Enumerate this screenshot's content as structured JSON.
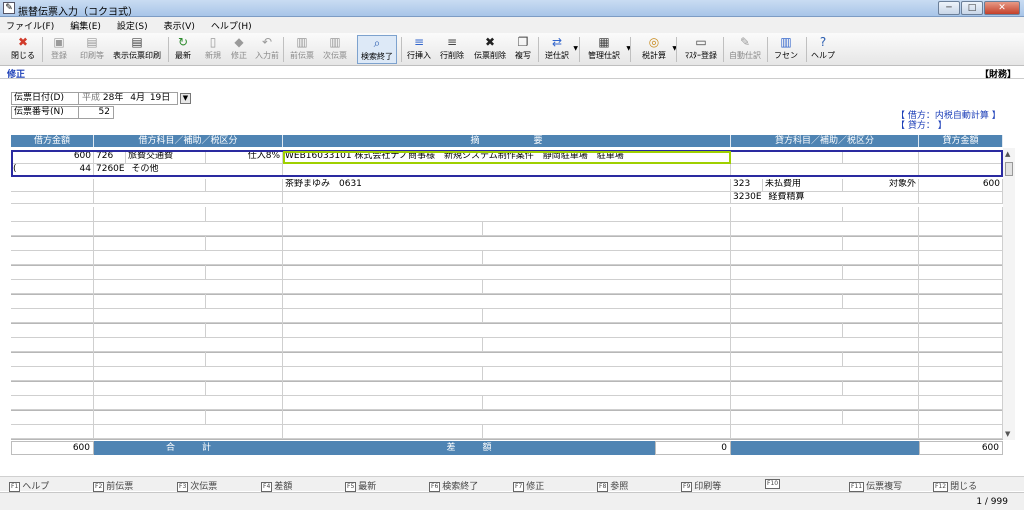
{
  "window": {
    "app_icon": "ledger-icon",
    "title": "振替伝票入力（コクヨ式）",
    "buttons": {
      "minimize": "─",
      "maximize": "□",
      "close": "✕"
    }
  },
  "menu": [
    "ファイル(F)",
    "編集(E)",
    "設定(S)",
    "表示(V)",
    "ヘルプ(H)"
  ],
  "toolbar": [
    {
      "id": "close",
      "label": "閉じる",
      "icon": "✖",
      "color": "#d13b2b",
      "enabled": true
    },
    {
      "id": "register",
      "label": "登録",
      "icon": "▣",
      "color": "#9a9a9a",
      "enabled": false
    },
    {
      "id": "print",
      "label": "印刷等",
      "icon": "▤",
      "color": "#9a9a9a",
      "enabled": false
    },
    {
      "id": "print-shown",
      "label": "表示伝票印刷",
      "icon": "▤",
      "color": "#444444",
      "enabled": true
    },
    {
      "id": "refresh",
      "label": "最新",
      "icon": "↻",
      "color": "#2e8b2e",
      "enabled": true
    },
    {
      "id": "new",
      "label": "新規",
      "icon": "▯",
      "color": "#9a9a9a",
      "enabled": false
    },
    {
      "id": "edit",
      "label": "修正",
      "icon": "◆",
      "color": "#9a9a9a",
      "enabled": false
    },
    {
      "id": "input-prev",
      "label": "入力前",
      "icon": "↶",
      "color": "#9a9a9a",
      "enabled": false
    },
    {
      "id": "prev-slip",
      "label": "前伝票",
      "icon": "▥",
      "color": "#9a9a9a",
      "enabled": false
    },
    {
      "id": "next-slip",
      "label": "次伝票",
      "icon": "▥",
      "color": "#9a9a9a",
      "enabled": false
    },
    {
      "id": "search-end",
      "label": "検索終了",
      "icon": "⌕",
      "color": "#2a5db0",
      "enabled": true,
      "pressed": true
    },
    {
      "id": "row-insert",
      "label": "行挿入",
      "icon": "≡",
      "color": "#3366cc",
      "enabled": true
    },
    {
      "id": "row-delete",
      "label": "行削除",
      "icon": "≡",
      "color": "#444444",
      "enabled": true
    },
    {
      "id": "slip-delete",
      "label": "伝票削除",
      "icon": "✖",
      "color": "#222222",
      "enabled": true
    },
    {
      "id": "copy",
      "label": "複写",
      "icon": "❐",
      "color": "#444444",
      "enabled": true
    },
    {
      "id": "reverse-journal",
      "label": "逆仕訳",
      "icon": "⇄",
      "color": "#3366cc",
      "enabled": true,
      "dropdown": true
    },
    {
      "id": "mgmt-journal",
      "label": "管理仕訳",
      "icon": "▦",
      "color": "#444444",
      "enabled": true,
      "dropdown": true
    },
    {
      "id": "tax-calc",
      "label": "税計算",
      "icon": "◎",
      "color": "#c88a1c",
      "enabled": true,
      "dropdown": true
    },
    {
      "id": "master-register",
      "label": "ﾏｽﾀｰ登録",
      "icon": "▭",
      "color": "#444444",
      "enabled": true
    },
    {
      "id": "auto-journal",
      "label": "自動仕訳",
      "icon": "✎",
      "color": "#9a9a9a",
      "enabled": false
    },
    {
      "id": "sticky-note",
      "label": "フセン",
      "icon": "▥",
      "color": "#3366cc",
      "enabled": true
    },
    {
      "id": "help",
      "label": "ヘルプ",
      "icon": "?",
      "color": "#2a5db0",
      "enabled": true
    }
  ],
  "mode": {
    "label": "修正",
    "right": "【財務】"
  },
  "header": {
    "date_label": "伝票日付(D)",
    "era": "平成",
    "year": "28年",
    "month": "4月",
    "day": "19日",
    "number_label": "伝票番号(N)",
    "number": "52"
  },
  "tax_info": {
    "debit": "【 借方：内税自動計算 】",
    "credit": "【 貸方：                    】"
  },
  "columns": {
    "debit_amount": "借方金額",
    "debit_account": "借方科目／補助／税区分",
    "description": "摘　　　　　　要",
    "credit_account": "貸方科目／補助／税区分",
    "credit_amount": "貸方金額"
  },
  "rows": [
    {
      "debit_amount": "600",
      "debit_code": "726",
      "debit_name": "旅費交通費",
      "debit_tax": "仕入8%",
      "sub_prefix": "(",
      "sub_amount": "44",
      "sub_code": "7260E",
      "sub_name": "その他",
      "description": "WEB16033101 株式会社ナノ商事様　新規システム制作案件　静岡駐車場　駐車場"
    },
    {
      "description": "茶野まゆみ　0631",
      "credit_code": "323",
      "credit_name": "未払費用",
      "credit_tax": "対象外",
      "credit_amount": "600",
      "credit_sub_code": "3230E",
      "credit_sub_name": "経費精算"
    }
  ],
  "totals": {
    "debit_total": "600",
    "total_label": "合　　　計",
    "diff_label": "差　　　額",
    "diff_value": "0",
    "credit_total": "600"
  },
  "fkeys": [
    {
      "key": "F1",
      "label": "ヘルプ"
    },
    {
      "key": "F2",
      "label": "前伝票"
    },
    {
      "key": "F3",
      "label": "次伝票"
    },
    {
      "key": "F4",
      "label": "差額"
    },
    {
      "key": "F5",
      "label": "最新"
    },
    {
      "key": "F6",
      "label": "検索終了"
    },
    {
      "key": "F7",
      "label": "修正"
    },
    {
      "key": "F8",
      "label": "参照"
    },
    {
      "key": "F9",
      "label": "印刷等"
    },
    {
      "key": "F10",
      "label": ""
    },
    {
      "key": "F11",
      "label": "伝票複写"
    },
    {
      "key": "F12",
      "label": "閉じる"
    }
  ],
  "status": {
    "page": "1 / 999"
  }
}
